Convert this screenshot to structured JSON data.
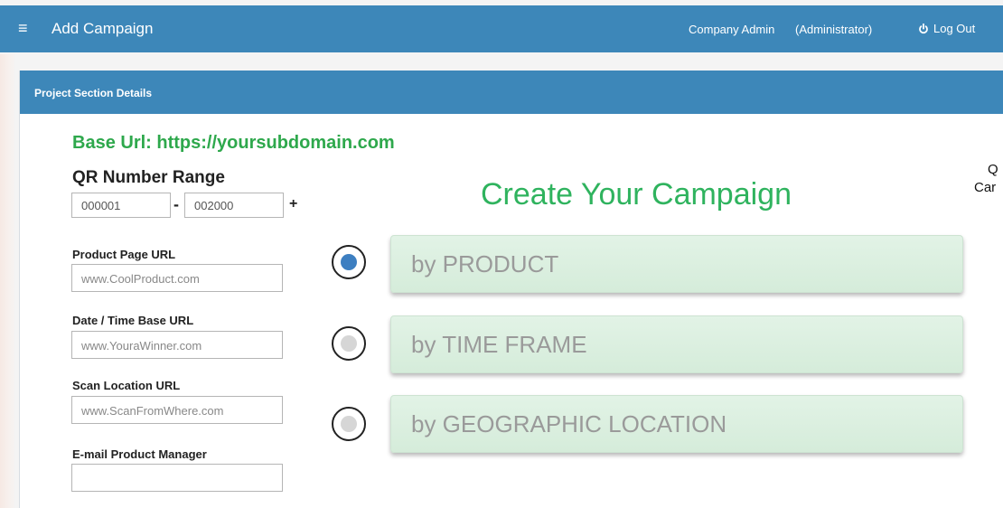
{
  "topbar": {
    "menu_icon": "≡",
    "title": "Add Campaign",
    "user": "Company Admin",
    "role": "(Administrator)",
    "logout": "Log Out"
  },
  "panel": {
    "header": "Project Section Details"
  },
  "form": {
    "base_url": "Base Url: https://yoursubdomain.com",
    "qr_range_title": "QR Number Range",
    "qr_start": "000001",
    "qr_dash": "-",
    "qr_end": "002000",
    "qr_plus": "+",
    "product_url_label": "Product Page URL",
    "product_url_placeholder": "www.CoolProduct.com",
    "datetime_url_label": "Date / Time Base URL",
    "datetime_url_placeholder": "www.YouraWinner.com",
    "scan_url_label": "Scan Location URL",
    "scan_url_placeholder": "www.ScanFromWhere.com",
    "email_label": "E-mail Product Manager",
    "email_value": ""
  },
  "campaign": {
    "title": "Create Your Campaign",
    "options": [
      {
        "label": "by PRODUCT",
        "selected": true
      },
      {
        "label": "by TIME FRAME",
        "selected": false
      },
      {
        "label": "by GEOGRAPHIC LOCATION",
        "selected": false
      }
    ]
  },
  "clipped_text": {
    "line1": "Q",
    "line2": "Car"
  },
  "colors": {
    "primary": "#3d87b9",
    "accent_green": "#2ea84c",
    "radio_selected": "#3d7fc1",
    "radio_unselected": "#d6d6d6"
  }
}
